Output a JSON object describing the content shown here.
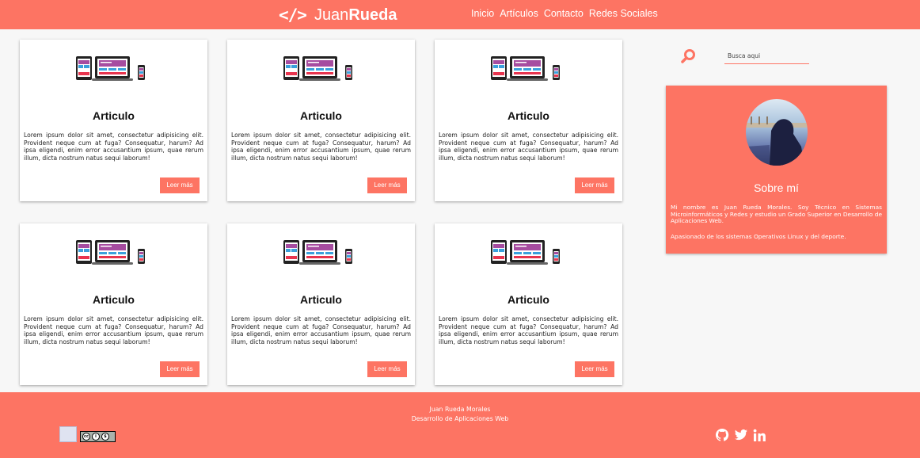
{
  "header": {
    "logo_code": "</>",
    "logo_first": "Juan",
    "logo_last": "Rueda",
    "nav": [
      "Inicio",
      "Artículos",
      "Contacto",
      "Redes Sociales"
    ]
  },
  "articles": [
    {
      "title": "Articulo",
      "text": "Lorem ipsum dolor sit amet, consectetur adipisicing elit. Provident neque cum at fuga? Consequatur, harum? Ad ipsa eligendi, enim error accusantium ipsum, quae rerum illum, dicta nostrum natus sequi laborum!",
      "button": "Leer más"
    },
    {
      "title": "Articulo",
      "text": "Lorem ipsum dolor sit amet, consectetur adipisicing elit. Provident neque cum at fuga? Consequatur, harum? Ad ipsa eligendi, enim error accusantium ipsum, quae rerum illum, dicta nostrum natus sequi laborum!",
      "button": "Leer más"
    },
    {
      "title": "Articulo",
      "text": "Lorem ipsum dolor sit amet, consectetur adipisicing elit. Provident neque cum at fuga? Consequatur, harum? Ad ipsa eligendi, enim error accusantium ipsum, quae rerum illum, dicta nostrum natus sequi laborum!",
      "button": "Leer más"
    },
    {
      "title": "Articulo",
      "text": "Lorem ipsum dolor sit amet, consectetur adipisicing elit. Provident neque cum at fuga? Consequatur, harum? Ad ipsa eligendi, enim error accusantium ipsum, quae rerum illum, dicta nostrum natus sequi laborum!",
      "button": "Leer más"
    },
    {
      "title": "Articulo",
      "text": "Lorem ipsum dolor sit amet, consectetur adipisicing elit. Provident neque cum at fuga? Consequatur, harum? Ad ipsa eligendi, enim error accusantium ipsum, quae rerum illum, dicta nostrum natus sequi laborum!",
      "button": "Leer más"
    },
    {
      "title": "Articulo",
      "text": "Lorem ipsum dolor sit amet, consectetur adipisicing elit. Provident neque cum at fuga? Consequatur, harum? Ad ipsa eligendi, enim error accusantium ipsum, quae rerum illum, dicta nostrum natus sequi laborum!",
      "button": "Leer más"
    }
  ],
  "sidebar": {
    "search_placeholder": "Busca aqui",
    "about_title": "Sobre mí",
    "about_text": "Mi nombre es Juan Rueda Morales. Soy Técnico en Sistemas Microinformáticos y Redes y estudio un Grado Superior en Desarrollo de Aplicaciones Web.",
    "about_text2": "Apasionado de los sistemas Operativos Linux y del deporte."
  },
  "footer": {
    "name": "Juan Rueda Morales",
    "role": "Desarrollo de Aplicaciones Web",
    "social_icons": [
      "github-icon",
      "twitter-icon",
      "linkedin-icon"
    ]
  },
  "colors": {
    "accent": "#fd7463",
    "background": "#f7f7f7",
    "card": "#ffffff"
  }
}
